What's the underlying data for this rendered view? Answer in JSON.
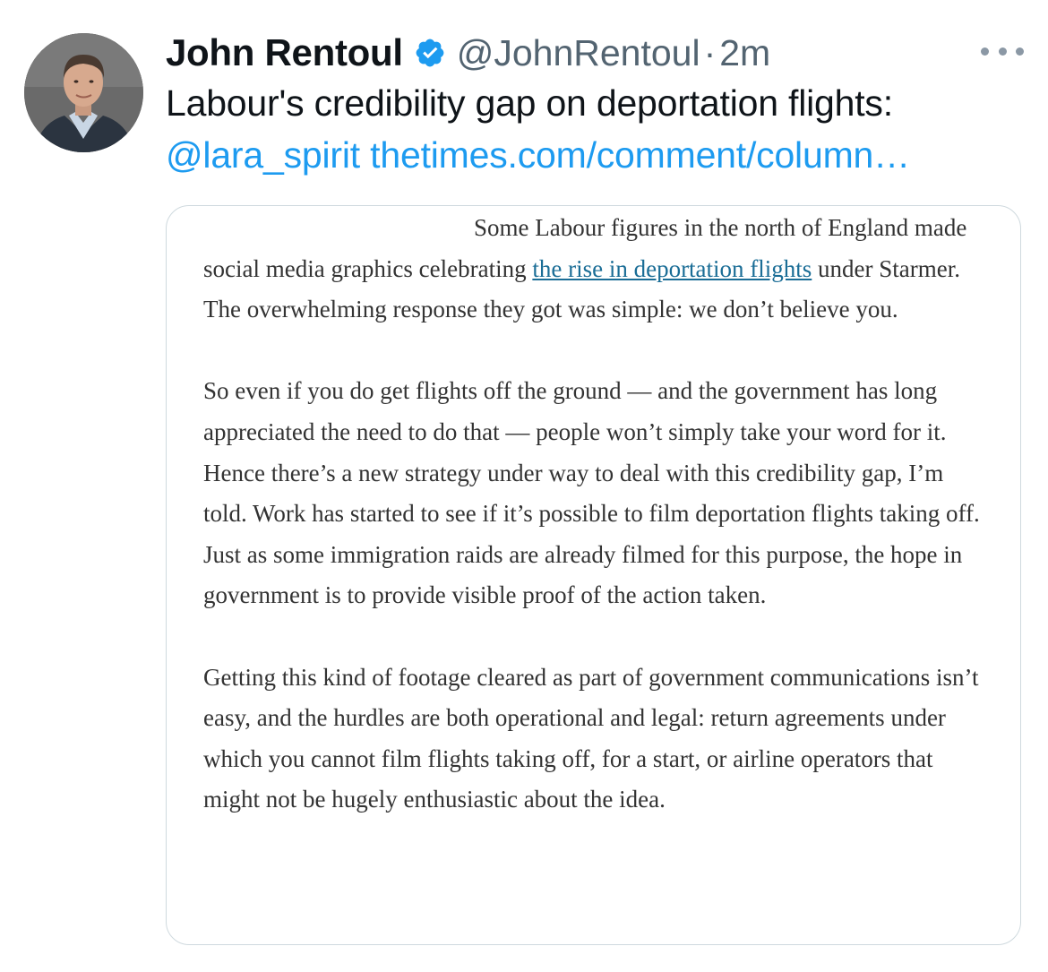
{
  "tweet": {
    "author_name": "John Rentoul",
    "handle": "@JohnRentoul",
    "separator": "·",
    "time": "2m",
    "text": "Labour's credibility gap on deportation flights:",
    "mention": "@lara_spirit",
    "link": "thetimes.com/comment/column…"
  },
  "icons": {
    "verified": "verified-badge-icon",
    "more": "more-options-icon"
  },
  "colors": {
    "link_blue": "#1d9bf0",
    "verified_blue": "#1d9bf0",
    "article_link": "#1a6d96"
  },
  "article": {
    "p1_before_link": "Some Labour figures in the north of England made social media graphics celebrating ",
    "p1_link": "the rise in deportation flights",
    "p1_after_link": " under Starmer. The overwhelming response they got was simple: we don’t believe you.",
    "p2": "So even if you do get flights off the ground — and the government has long appreciated the need to do that — people won’t simply take your word for it. Hence there’s a new strategy under way to deal with this credibility gap, I’m told. Work has started to see if it’s possible to film deportation flights taking off. Just as some immigration raids are already filmed for this purpose, the hope in government is to provide visible proof of the action taken.",
    "p3": "Getting this kind of footage cleared as part of government communications isn’t easy, and the hurdles are both operational and legal: return agreements under which you cannot film flights taking off, for a start, or airline operators that might not be hugely enthusiastic about the idea."
  }
}
